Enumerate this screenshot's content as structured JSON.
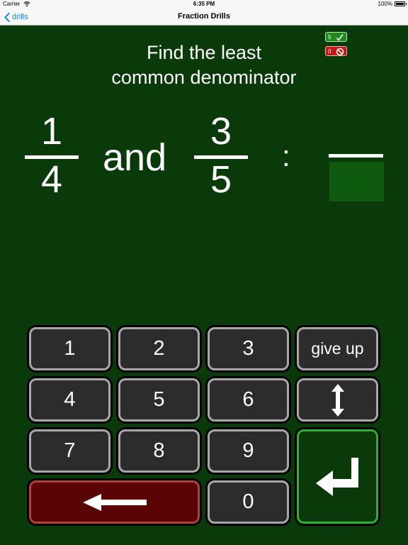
{
  "status_bar": {
    "carrier": "Carrier",
    "time": "6:35 PM",
    "battery": "100%"
  },
  "nav": {
    "back_label": "drills",
    "title": "Fraction Drills"
  },
  "score": {
    "correct": "5",
    "wrong": "0"
  },
  "prompt": {
    "line1": "Find the least",
    "line2": "common denominator"
  },
  "problem": {
    "fraction1": {
      "numerator": "1",
      "denominator": "4"
    },
    "connector": "and",
    "fraction2": {
      "numerator": "3",
      "denominator": "5"
    },
    "separator": ":"
  },
  "answer": {
    "value": ""
  },
  "keypad": {
    "k1": "1",
    "k2": "2",
    "k3": "3",
    "give_up": "give up",
    "k4": "4",
    "k5": "5",
    "k6": "6",
    "k7": "7",
    "k8": "8",
    "k9": "9",
    "k0": "0"
  },
  "colors": {
    "background": "#0a3a0a",
    "answer_box": "#0e5a0e",
    "correct": "#1e8a1e",
    "wrong": "#c41818",
    "back_link": "#1a7cf5"
  }
}
